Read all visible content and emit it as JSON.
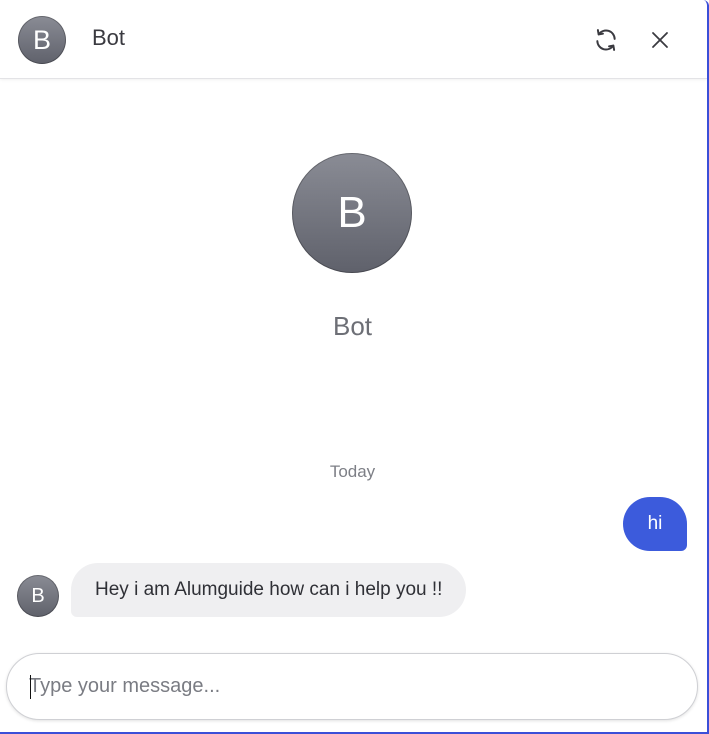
{
  "header": {
    "avatar_initial": "B",
    "title": "Bot",
    "refresh_icon": "refresh-icon",
    "close_icon": "close-icon"
  },
  "intro": {
    "avatar_initial": "B",
    "name": "Bot"
  },
  "conversation": {
    "date_separator": "Today",
    "messages": [
      {
        "sender": "user",
        "text": "hi"
      },
      {
        "sender": "bot",
        "avatar_initial": "B",
        "text": "Hey i am Alumguide how can i help you !!"
      }
    ]
  },
  "composer": {
    "value": "",
    "placeholder": "Type your message..."
  },
  "colors": {
    "accent": "#3c5bdc",
    "avatar": "#6f717a",
    "bot_bubble": "#efeff1"
  }
}
